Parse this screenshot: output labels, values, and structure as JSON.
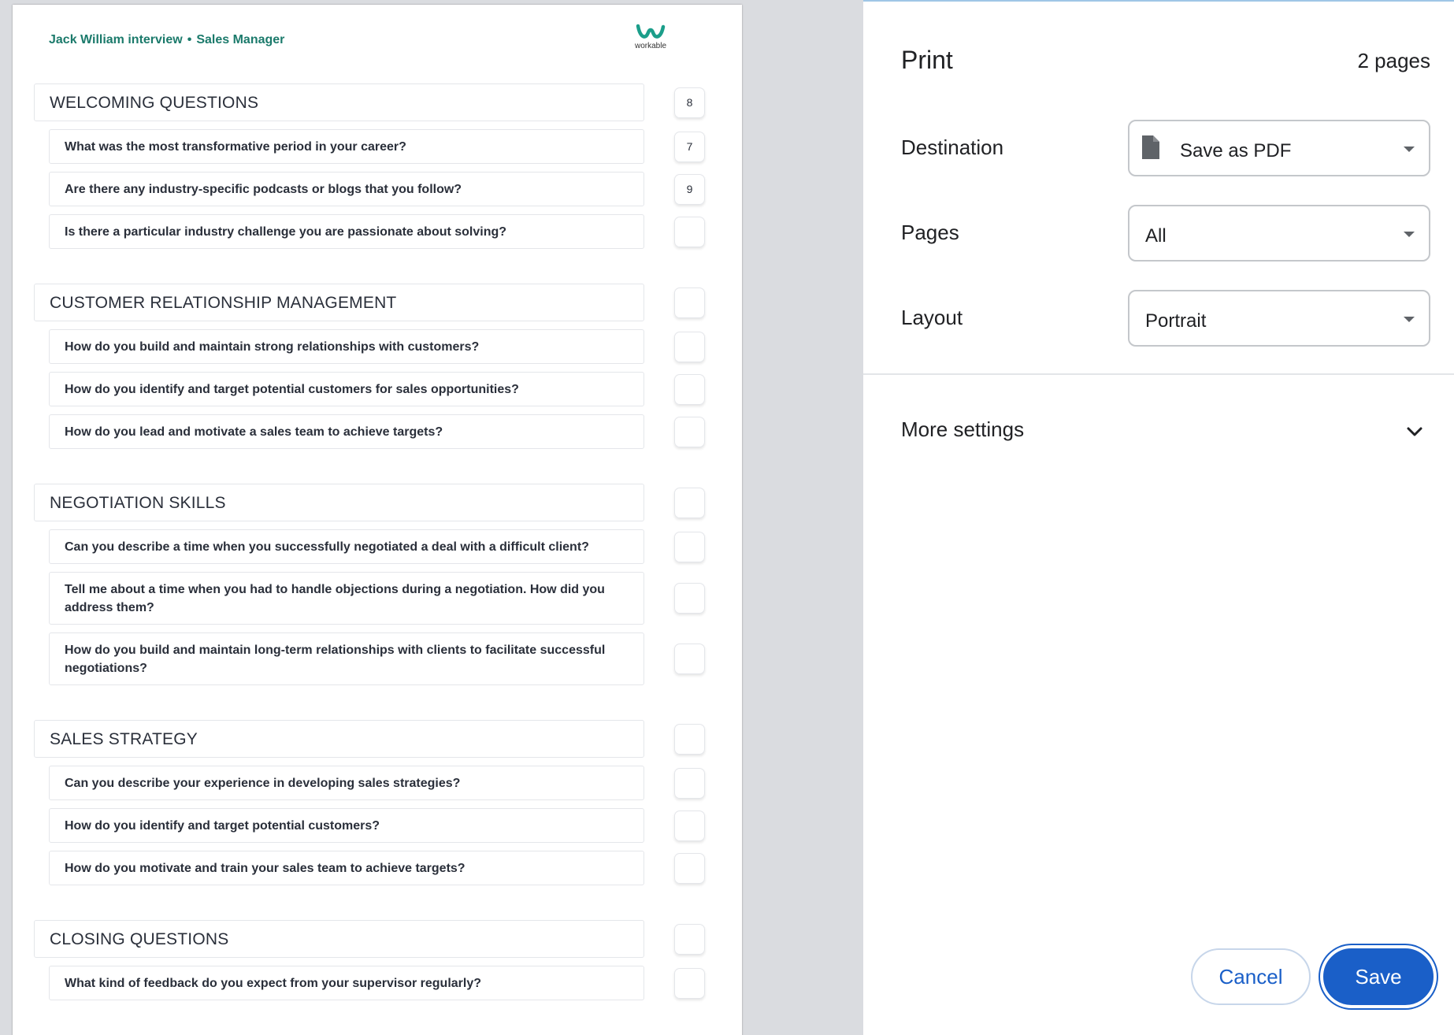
{
  "preview": {
    "header": {
      "candidate": "Jack William interview",
      "separator": "•",
      "role": "Sales Manager"
    },
    "logo": {
      "text": "workable"
    },
    "sections": [
      {
        "title": "WELCOMING QUESTIONS",
        "score": "8",
        "questions": [
          {
            "text": "What was the most transformative period in your career?",
            "score": "7"
          },
          {
            "text": "Are there any industry-specific podcasts or blogs that you follow?",
            "score": "9"
          },
          {
            "text": "Is there a particular industry challenge you are passionate about solving?",
            "score": ""
          }
        ]
      },
      {
        "title": "CUSTOMER RELATIONSHIP MANAGEMENT",
        "score": "",
        "questions": [
          {
            "text": "How do you build and maintain strong relationships with customers?",
            "score": ""
          },
          {
            "text": "How do you identify and target potential customers for sales opportunities?",
            "score": ""
          },
          {
            "text": "How do you lead and motivate a sales team to achieve targets?",
            "score": ""
          }
        ]
      },
      {
        "title": "NEGOTIATION SKILLS",
        "score": "",
        "questions": [
          {
            "text": "Can you describe a time when you successfully negotiated a deal with a difficult client?",
            "score": ""
          },
          {
            "text": "Tell me about a time when you had to handle objections during a negotiation. How did you address them?",
            "score": ""
          },
          {
            "text": "How do you build and maintain long-term relationships with clients to facilitate successful negotiations?",
            "score": ""
          }
        ]
      },
      {
        "title": "SALES STRATEGY",
        "score": "",
        "questions": [
          {
            "text": "Can you describe your experience in developing sales strategies?",
            "score": ""
          },
          {
            "text": "How do you identify and target potential customers?",
            "score": ""
          },
          {
            "text": "How do you motivate and train your sales team to achieve targets?",
            "score": ""
          }
        ]
      },
      {
        "title": "CLOSING QUESTIONS",
        "score": "",
        "questions": [
          {
            "text": "What kind of feedback do you expect from your supervisor regularly?",
            "score": ""
          }
        ]
      }
    ]
  },
  "settings": {
    "title": "Print",
    "page_count": "2 pages",
    "destination": {
      "label": "Destination",
      "value": "Save as PDF",
      "icon": "file-icon"
    },
    "pages": {
      "label": "Pages",
      "value": "All"
    },
    "layout": {
      "label": "Layout",
      "value": "Portrait"
    },
    "more_settings": {
      "label": "More settings",
      "icon": "chevron-down-icon"
    },
    "buttons": {
      "cancel": "Cancel",
      "save": "Save"
    }
  },
  "colors": {
    "accent": "#1a5fc8",
    "brand": "#1b7a6b",
    "preview_bg": "#dadce0"
  }
}
